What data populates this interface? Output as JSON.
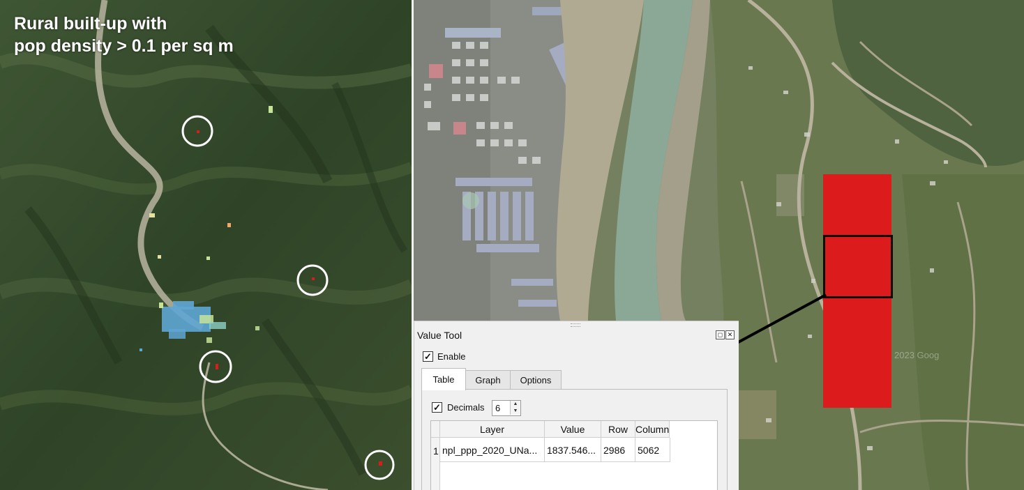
{
  "left_map": {
    "title_line1": "Rural built-up with",
    "title_line2": "pop density > 0.1 per sq m"
  },
  "right_map": {
    "highlight_color": "#dc1c1c",
    "watermark": "2023 Goog"
  },
  "value_tool": {
    "title": "Value Tool",
    "enable_label": "Enable",
    "enable_checked": "✓",
    "tabs": [
      {
        "label": "Table"
      },
      {
        "label": "Graph"
      },
      {
        "label": "Options"
      }
    ],
    "decimals_label": "Decimals",
    "decimals_checked": "✓",
    "decimals_value": "6",
    "table": {
      "headers": [
        "Layer",
        "Value",
        "Row",
        "Column"
      ],
      "rows": [
        {
          "index": "1",
          "layer": "npl_ppp_2020_UNa...",
          "value": "1837.546...",
          "row": "2986",
          "column": "5062"
        }
      ]
    }
  }
}
